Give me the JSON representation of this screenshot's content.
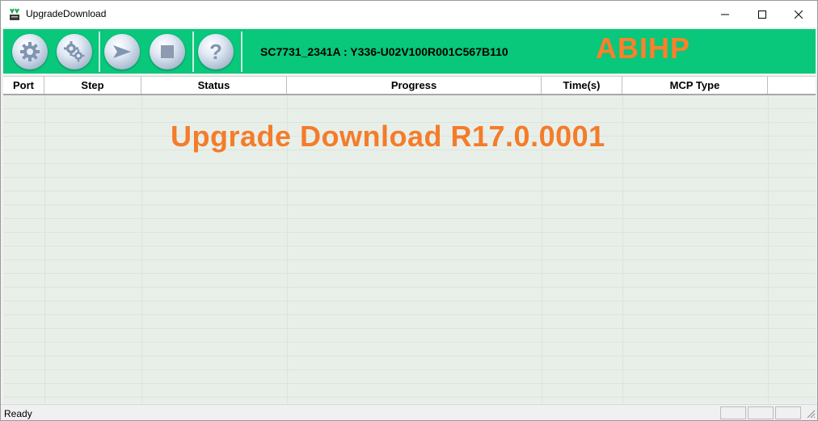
{
  "window": {
    "title": "UpgradeDownload"
  },
  "toolbar": {
    "buttons": [
      {
        "name": "settings",
        "icon": "gear-icon"
      },
      {
        "name": "advanced-settings",
        "icon": "gears-icon"
      },
      {
        "name": "start",
        "icon": "play-arrow-icon"
      },
      {
        "name": "stop",
        "icon": "stop-icon"
      },
      {
        "name": "help",
        "icon": "question-icon",
        "glyph": "?"
      }
    ],
    "info": "SC7731_2341A : Y336-U02V100R001C567B110",
    "brand": "ABIHP",
    "background": "#09c77b"
  },
  "table": {
    "columns": [
      "Port",
      "Step",
      "Status",
      "Progress",
      "Time(s)",
      "MCP Type",
      ""
    ]
  },
  "overlay": {
    "title": "Upgrade Download R17.0.0001",
    "color": "#f47c2a"
  },
  "status": {
    "text": "Ready"
  }
}
